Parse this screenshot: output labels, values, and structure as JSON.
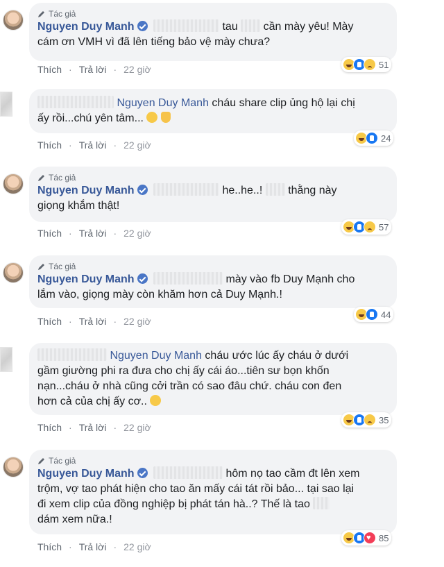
{
  "labels": {
    "author": "Tác giả",
    "like": "Thích",
    "reply": "Trả lời"
  },
  "comments": [
    {
      "name": "Nguyen Duy Manh",
      "text": "tau [...] cần mày yêu! Mày cám ơn VMH vì đã lên tiếng bảo vệ mày chưa?",
      "line1_a": "tau",
      "line1_b": "cần mày yêu! Mày",
      "line2": "cám ơn VMH vì đã lên tiếng bảo vệ mày chưa?",
      "time": "22 giờ",
      "reactions": [
        "haha",
        "like",
        "sad"
      ],
      "count": "51"
    },
    {
      "name": "Nguyen Duy Manh",
      "line1": "cháu share clip ủng hộ lại chị",
      "line2": "ấy rồi...chú yên tâm...",
      "time": "22 giờ",
      "reactions": [
        "haha",
        "like"
      ],
      "count": "24"
    },
    {
      "name": "Nguyen Duy Manh",
      "line1_a": "he..he..!",
      "line1_b": "thằng này",
      "line2": "giọng khắm thật!",
      "time": "22 giờ",
      "reactions": [
        "haha",
        "like",
        "sad"
      ],
      "count": "57"
    },
    {
      "name": "Nguyen Duy Manh",
      "line1": "mày vào fb Duy Mạnh cho",
      "line2": "lắm vào, giọng mày còn khăm hơn cả Duy Mạnh.!",
      "time": "22 giờ",
      "reactions": [
        "haha",
        "like"
      ],
      "count": "44"
    },
    {
      "name": "Nguyen Duy Manh",
      "line1": "cháu ước lúc ấy cháu ở dưới",
      "line2": "gầm giường phi ra đưa cho chị ấy cái áo...tiên sư bọn khốn",
      "line3_a": "nạn...cháu ở nhà cũng cởi trần có sao đâu chứ.",
      "line3_b": "cháu con đen",
      "line4": "hơn cả của chị ấy cơ..",
      "time": "22 giờ",
      "reactions": [
        "haha",
        "like",
        "sad"
      ],
      "count": "35"
    },
    {
      "name": "Nguyen Duy Manh",
      "line1": "hôm nọ tao cầm đt lên xem",
      "line2": "trộm, vợ tao phát hiện cho tao ăn mấy cái tát rồi bảo... tại sao lại",
      "line3_a": "đi xem clip của đồng nghiệp bị phát tán hà..? Thế là tao",
      "line4": "dám xem nữa.!",
      "time": "22 giờ",
      "reactions": [
        "haha",
        "like",
        "love"
      ],
      "count": "85"
    }
  ]
}
